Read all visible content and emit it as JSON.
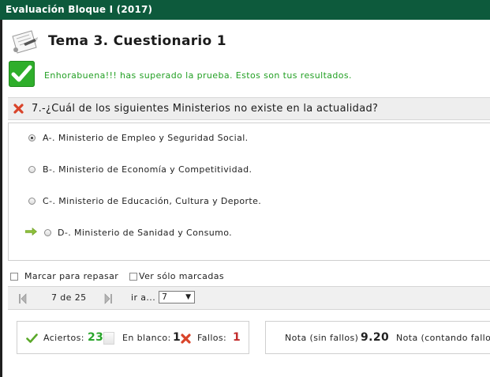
{
  "window": {
    "title": "Evaluación Bloque I (2017)"
  },
  "header": {
    "title": "Tema 3. Cuestionario 1",
    "icon": "exam-paper-icon"
  },
  "result": {
    "message": "Enhorabuena!!! has superado la prueba. Estos son tus resultados.",
    "icon": "green-check-icon"
  },
  "question": {
    "text": "7.-¿Cuál de los siguientes Ministerios no existe en la actualidad?",
    "status_icon": "red-x-icon",
    "options": [
      {
        "label": "A-. Ministerio de Empleo y Seguridad Social.",
        "selected": true
      },
      {
        "label": "B-. Ministerio de Economía y Competitividad.",
        "selected": false
      },
      {
        "label": "C-. Ministerio de Educación, Cultura y Deporte.",
        "selected": false
      },
      {
        "label": "D-. Ministerio de Sanidad y Consumo.",
        "selected": false,
        "correct": true
      }
    ]
  },
  "filters": {
    "mark_label": "Marcar para repasar",
    "marked_only_label": "Ver sólo marcadas"
  },
  "navigation": {
    "page_info": "7 de 25",
    "goto_label": "ir a...",
    "goto_value": "7"
  },
  "stats": {
    "correct_label": "Aciertos:",
    "correct_value": "23",
    "blank_label": "En blanco:",
    "blank_value": "1",
    "wrong_label": "Fallos:",
    "wrong_value": "1"
  },
  "grade": {
    "no_penalty_label": "Nota (sin fallos)",
    "no_penalty_value": "9.20",
    "with_penalty_label": "Nota (contando fallos)"
  },
  "colors": {
    "titlebar": "#0d5a3c",
    "success": "#2aa52c",
    "error": "#c22b2b"
  }
}
